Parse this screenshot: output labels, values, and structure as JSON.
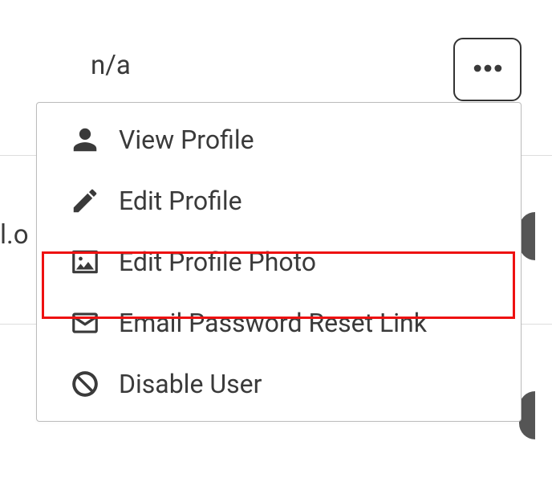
{
  "top": {
    "na": "n/a"
  },
  "edge_text": "l.o",
  "menu": {
    "view_profile": "View Profile",
    "edit_profile": "Edit Profile",
    "edit_photo": "Edit Profile Photo",
    "email_reset": "Email Password Reset Link",
    "disable_user": "Disable User"
  }
}
